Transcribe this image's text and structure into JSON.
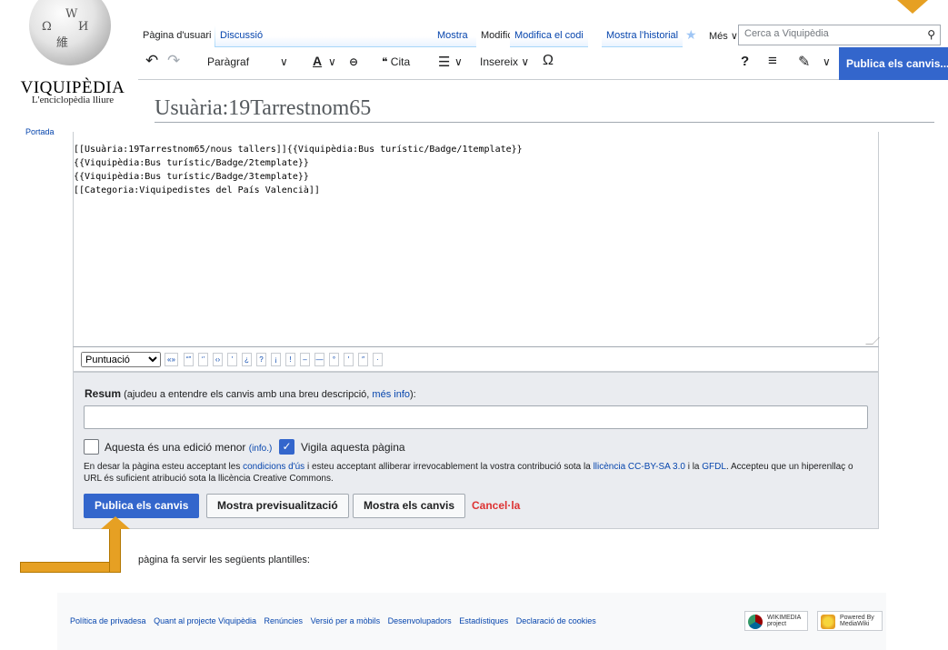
{
  "logo": {
    "wordmark": "VIQUIPÈDIA",
    "tagline": "L'enciclopèdia lliure",
    "nav_partial": "Portada"
  },
  "tabs": {
    "user_page": "Pàgina d'usuari",
    "discussion": "Discussió",
    "show": "Mostra",
    "edit": "Modifica",
    "edit_code": "Modifica el codi",
    "history": "Mostra l'historial",
    "more": "Més ∨"
  },
  "search": {
    "placeholder": "Cerca a Viquipèdia"
  },
  "toolbar": {
    "undo": "↶",
    "redo": "↷",
    "paragraph": "Paràgraf",
    "text_style": "A",
    "link": "⊖",
    "cite": "❝ Cita",
    "list": "☰",
    "insert": "Insereix",
    "special_char": "Ω",
    "help": "?",
    "menu": "≡",
    "edit_mode": "✎",
    "publish": "Publica els canvis..."
  },
  "page": {
    "title": "Usuària:19Tarrestnom65"
  },
  "editor": {
    "content": "[[Usuària:19Tarrestnom65/nous tallers]]{{Viquipèdia:Bus turístic/Badge/1template}}\n{{Viquipèdia:Bus turístic/Badge/2template}}\n{{Viquipèdia:Bus turístic/Badge/3template}}\n[[Categoria:Viquipedistes del País Valencià]]"
  },
  "charbar": {
    "selected": "Puntuació",
    "chars": [
      "«»",
      "“”",
      "‘’",
      "‹›",
      "'",
      "¿",
      "?",
      "¡",
      "!",
      "–",
      "—",
      "°",
      "′",
      "″",
      "·"
    ]
  },
  "save": {
    "summary_label": "Resum",
    "summary_help": "(ajudeu a entendre els canvis amb una breu descripció,",
    "summary_help_link": "més info",
    "summary_help_end": "):",
    "minor_label": "Aquesta és una edició menor",
    "minor_info": "(info.)",
    "watch_label": "Vigila aquesta pàgina",
    "legal_1": "En desar la pàgina esteu acceptant les",
    "legal_terms_link": "condicions d'ús",
    "legal_2": "i esteu acceptant alliberar irrevocablement la vostra contribució sota la",
    "legal_license_link": "llicència CC-BY-SA 3.0",
    "legal_3": "i la",
    "legal_gfdl_link": "GFDL",
    "legal_4": ". Accepteu que un hiperenllaç o URL és suficient atribució sota la llicència Creative Commons.",
    "publish_button": "Publica els canvis",
    "preview_button": "Mostra previsualització",
    "diff_button": "Mostra els canvis",
    "cancel_button": "Cancel·la"
  },
  "templates_note": "pàgina fa servir les següents plantilles:",
  "footer": {
    "links": [
      "Política de privadesa",
      "Quant al projecte Viquipèdia",
      "Renúncies",
      "Versió per a mòbils",
      "Desenvolupadors",
      "Estadístiques",
      "Declaració de cookies"
    ],
    "badge_wikimedia": "WIKIMEDIA project",
    "badge_mediawiki": "Powered By MediaWiki"
  },
  "colors": {
    "accent": "#3366cc",
    "link": "#0645ad",
    "annotation": "#e6a023",
    "cancel": "#dd3333"
  }
}
